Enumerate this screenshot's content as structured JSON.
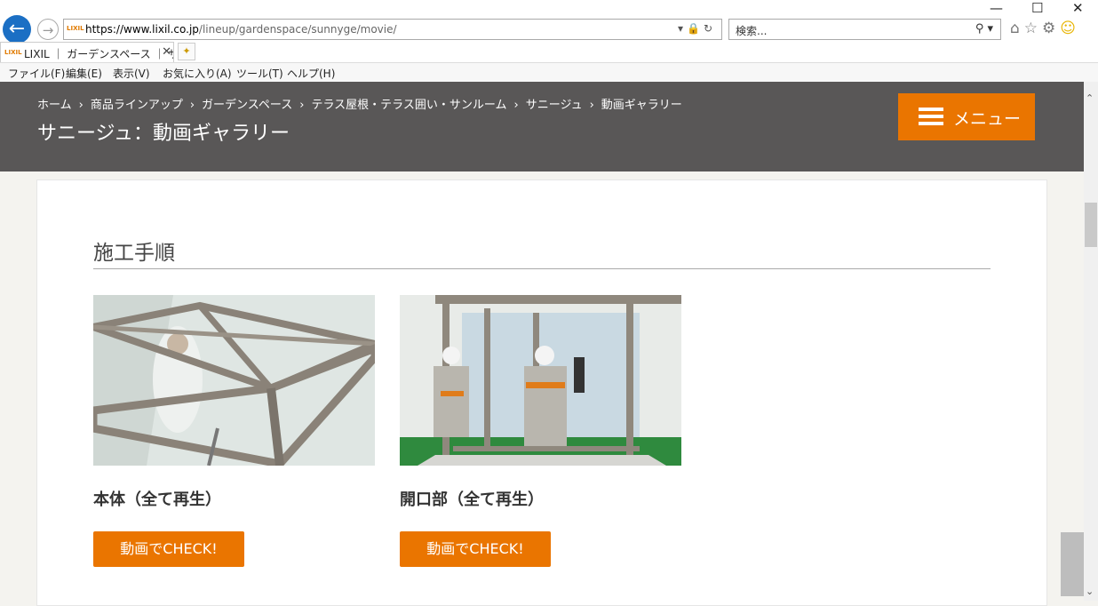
{
  "browser": {
    "url_host": "https://www.lixil.co.jp",
    "url_path": "/lineup/gardenspace/sunnyge/movie/",
    "favicon_text": "LIXIL",
    "search_placeholder": "検索...",
    "tab_title": "LIXIL ｜ ガーデンスペース ｜ サ...",
    "menu": [
      "ファイル(F)",
      "編集(E)",
      "表示(V)",
      "お気に入り(A)",
      "ツール(T)",
      "ヘルプ(H)"
    ]
  },
  "header": {
    "breadcrumbs": [
      "ホーム",
      "商品ラインアップ",
      "ガーデンスペース",
      "テラス屋根・テラス囲い・サンルーム",
      "サニージュ",
      "動画ギャラリー"
    ],
    "title": "サニージュ：動画ギャラリー",
    "menu_label": "メニュー"
  },
  "section": {
    "title": "施工手順",
    "items": [
      {
        "title": "本体（全て再生）",
        "button": "動画でCHECK!"
      },
      {
        "title": "開口部（全て再生）",
        "button": "動画でCHECK!"
      }
    ]
  },
  "colors": {
    "accent": "#ea7500",
    "header_bg": "#595757"
  }
}
